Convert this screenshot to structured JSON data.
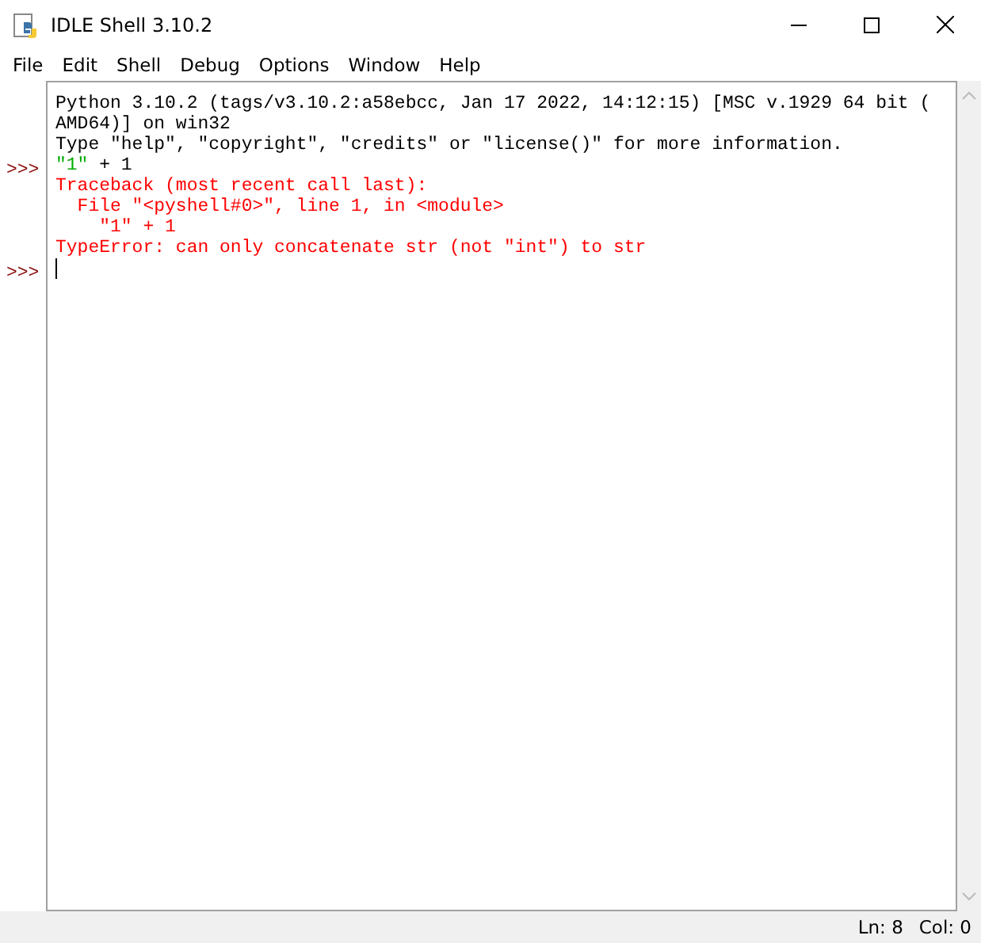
{
  "window": {
    "title": "IDLE Shell 3.10.2"
  },
  "menu": [
    "File",
    "Edit",
    "Shell",
    "Debug",
    "Options",
    "Window",
    "Help"
  ],
  "lines": [
    {
      "segments": [
        {
          "text": "Python 3.10.2 (tags/v3.10.2:a58ebcc, Jan 17 2022, 14:12:15) [MSC v.1929 64 bit (",
          "kind": "output"
        }
      ]
    },
    {
      "segments": [
        {
          "text": "AMD64)] on win32",
          "kind": "output"
        }
      ]
    },
    {
      "segments": [
        {
          "text": "Type \"help\", \"copyright\", \"credits\" or \"license()\" for more information.",
          "kind": "output"
        }
      ]
    },
    {
      "prompt": ">>>",
      "segments": [
        {
          "text": "\"1\"",
          "kind": "string"
        },
        {
          "text": " + 1",
          "kind": "output"
        }
      ]
    },
    {
      "segments": [
        {
          "text": "Traceback (most recent call last):",
          "kind": "error"
        }
      ]
    },
    {
      "segments": [
        {
          "text": "  File \"<pyshell#0>\", line 1, in <module>",
          "kind": "error"
        }
      ]
    },
    {
      "segments": [
        {
          "text": "    \"1\" + 1",
          "kind": "error"
        }
      ]
    },
    {
      "segments": [
        {
          "text": "TypeError: can only concatenate str (not \"int\") to str",
          "kind": "error"
        }
      ]
    },
    {
      "prompt": ">>>",
      "cursor": true
    }
  ],
  "status_bar": {
    "line": "Ln: 8",
    "column": "Col: 0"
  }
}
